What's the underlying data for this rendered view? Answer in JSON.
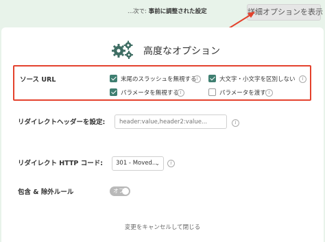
{
  "topbar": {
    "hint_prefix": "...次で: ",
    "hint_bold": "事前に調整された設定",
    "advanced_button": "詳細オプションを表示"
  },
  "panel": {
    "title": "高度なオプション",
    "icon": "gears-icon"
  },
  "source_url": {
    "label": "ソース URL",
    "options": [
      {
        "label": "末尾のスラッシュを無視する",
        "checked": true
      },
      {
        "label": "大文字・小文字を区別しない",
        "checked": true
      },
      {
        "label": "パラメータを無視する",
        "checked": true
      },
      {
        "label": "パラメータを渡す",
        "checked": false
      }
    ]
  },
  "redirect_headers": {
    "label": "リダイレクトヘッダーを設定:",
    "placeholder": "header:value,header2:value..."
  },
  "redirect_code": {
    "label": "リダイレクト HTTP コード:",
    "selected": "301 - Moved..."
  },
  "include_exclude": {
    "label": "包含 & 除外ルール",
    "toggle_text": "オフ",
    "enabled": false
  },
  "footer": {
    "cancel_link": "変更をキャンセルして閉じる"
  },
  "colors": {
    "background": "#e8f3ea",
    "accent": "#3f7f71",
    "highlight": "#e4412c",
    "toggle_off": "#b9b9b9"
  }
}
